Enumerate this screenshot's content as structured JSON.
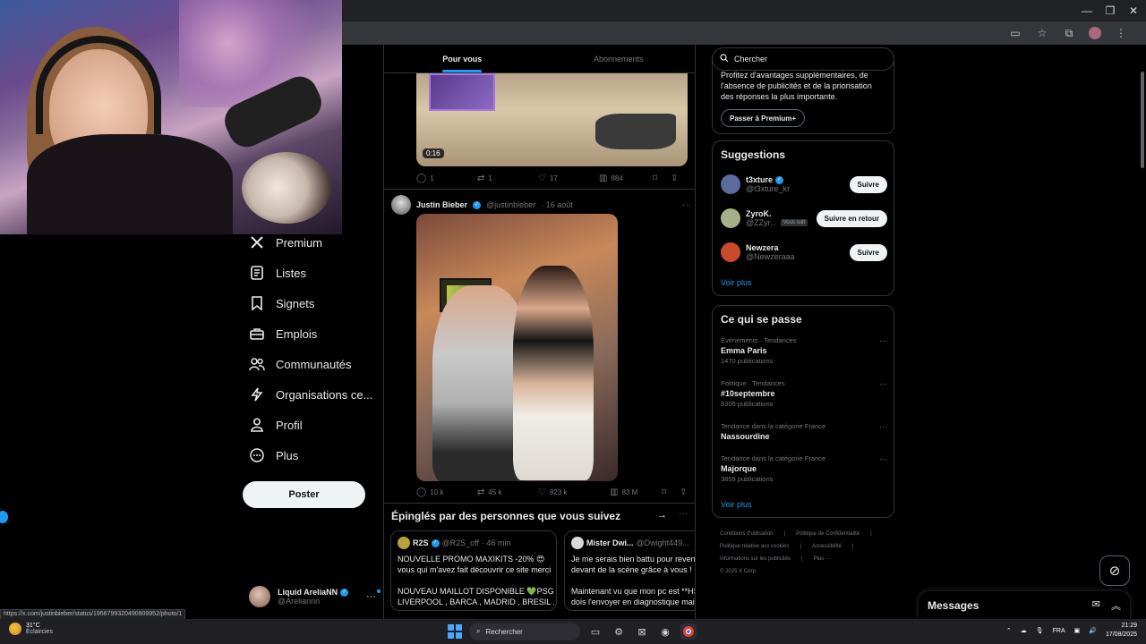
{
  "timeline": {
    "tabs": [
      {
        "label": "Pour vous",
        "active": true
      },
      {
        "label": "Abonnements",
        "active": false
      }
    ],
    "tweet1": {
      "duration": "0:16",
      "stats": {
        "replies": "1",
        "reposts": "1",
        "likes": "17",
        "views": "884"
      }
    },
    "tweet2": {
      "name": "Justin Bieber",
      "handle": "@justinbieber",
      "date": "· 16 août",
      "stats": {
        "replies": "10 k",
        "reposts": "45 k",
        "likes": "823 k",
        "views": "83 M"
      }
    },
    "pinned": {
      "title": "Épinglés par des personnes que vous suivez",
      "cards": [
        {
          "name": "R2S",
          "handle": "@R2S_off",
          "time": "· 46 min",
          "lines": [
            "NOUVELLE PROMO MAXIKITS -20% 😍",
            "vous qui m'avez fait découvrir ce site merci",
            "",
            "NOUVEAU MAILLOT DISPONIBLE 💚PSG ,",
            "LIVERPOOL , BARCA , MADRID , BRESIL ..."
          ]
        },
        {
          "name": "Mister Dwi...",
          "handle": "@Dwight449...",
          "time": "",
          "lines": [
            "Je me serais bien battu pour reveni",
            "devant de la scène grâce à vous !",
            "",
            "Maintenant vu que mon pc est **HS",
            "dois l'envoyer en diagnostique mais"
          ]
        }
      ]
    }
  },
  "nav": {
    "items": [
      {
        "label": "Premium",
        "icon": "x-logo-icon"
      },
      {
        "label": "Listes",
        "icon": "list-icon"
      },
      {
        "label": "Signets",
        "icon": "bookmark-icon"
      },
      {
        "label": "Emplois",
        "icon": "briefcase-icon"
      },
      {
        "label": "Communautés",
        "icon": "people-icon"
      },
      {
        "label": "Organisations ce...",
        "icon": "lightning-icon"
      },
      {
        "label": "Profil",
        "icon": "person-icon"
      },
      {
        "label": "Plus",
        "icon": "more-circle-icon"
      }
    ],
    "post_label": "Poster",
    "account": {
      "name": "Liquid AreliaNN",
      "handle": "@Areliannn"
    }
  },
  "sidebar": {
    "search_placeholder": "Chercher",
    "premium": {
      "text": "Profitez d'avantages supplémentaires, de l'absence de publicités et de la priorisation des réponses la plus importante.",
      "button": "Passer à Premium+"
    },
    "suggestions": {
      "title": "Suggestions",
      "items": [
        {
          "name": "t3xture",
          "handle": "@t3xture_kr",
          "follows_you": "",
          "button": "Suivre",
          "color": "#5a6b9c"
        },
        {
          "name": "ZyroK.",
          "handle": "@ZZyr...",
          "follows_you": "Vous suit",
          "button": "Suivre en retour",
          "color": "#a8b08a"
        },
        {
          "name": "Newzera",
          "handle": "@Newzeraaa",
          "follows_you": "",
          "button": "Suivre",
          "color": "#c84a2a"
        }
      ],
      "more": "Voir plus"
    },
    "trends": {
      "title": "Ce qui se passe",
      "items": [
        {
          "category": "Événements · Tendances",
          "name": "Emma Paris",
          "count": "1470 publications"
        },
        {
          "category": "Politique · Tendances",
          "name": "#10septembre",
          "count": "8306 publications"
        },
        {
          "category": "Tendance dans la catégorie France",
          "name": "Nassourdine",
          "count": ""
        },
        {
          "category": "Tendance dans la catégorie France",
          "name": "Majorque",
          "count": "3859 publications"
        }
      ],
      "more": "Voir plus"
    },
    "footer": {
      "line1": [
        "Conditions d'utilisation",
        "|",
        "Politique de Confidentialité",
        "|"
      ],
      "line2": [
        "Politique relative aux cookies",
        "|",
        "Accessibilité",
        "|"
      ],
      "line3": [
        "Informations sur les publicités",
        "|",
        "Plus ···"
      ],
      "line4": "© 2025 X Corp."
    }
  },
  "messages": {
    "title": "Messages"
  },
  "status_url": "https://x.com/justinbieber/status/1956799320490909952/photo/1",
  "taskbar": {
    "weather_temp": "31°C",
    "weather_desc": "Éclaircies",
    "search_label": "Rechercher",
    "lang": "FRA",
    "time": "21:29",
    "date": "17/08/2025"
  },
  "colors": {
    "accent": "#1d9bf0",
    "background": "#000000",
    "border": "#2f3336"
  }
}
